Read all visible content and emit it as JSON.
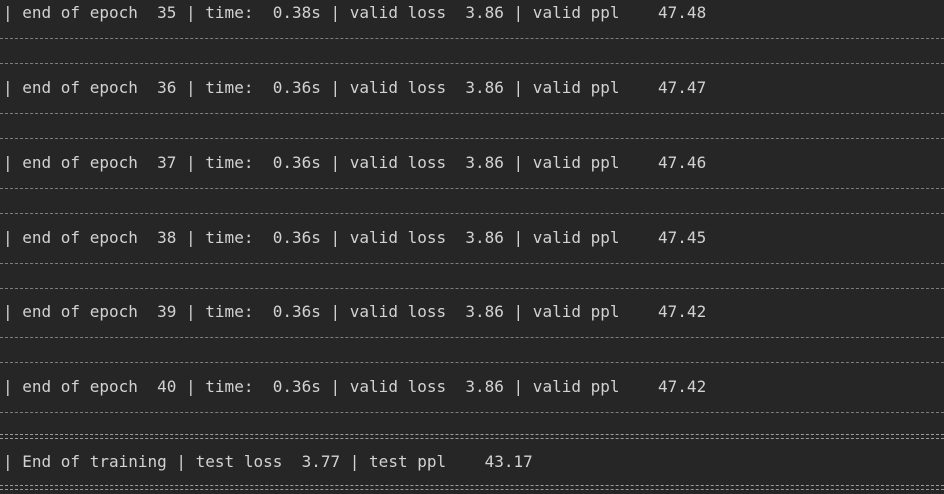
{
  "terminal": {
    "epoch_lines": [
      "| end of epoch  35 | time:  0.38s | valid loss  3.86 | valid ppl    47.48",
      "| end of epoch  36 | time:  0.36s | valid loss  3.86 | valid ppl    47.47",
      "| end of epoch  37 | time:  0.36s | valid loss  3.86 | valid ppl    47.46",
      "| end of epoch  38 | time:  0.36s | valid loss  3.86 | valid ppl    47.45",
      "| end of epoch  39 | time:  0.36s | valid loss  3.86 | valid ppl    47.42",
      "| end of epoch  40 | time:  0.36s | valid loss  3.86 | valid ppl    47.42"
    ],
    "final_line": "| End of training | test loss  3.77 | test ppl    43.17"
  }
}
